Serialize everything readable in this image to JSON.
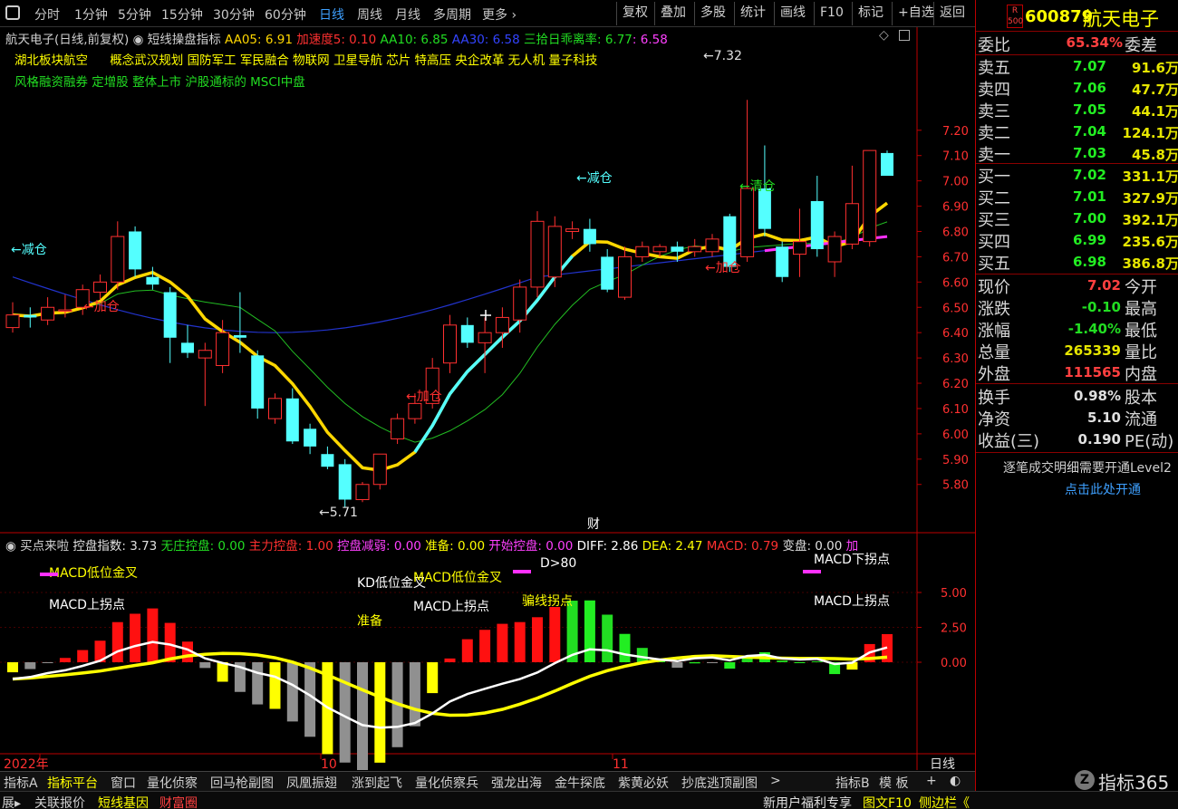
{
  "toolbar": {
    "periods": [
      "分时",
      "1分钟",
      "5分钟",
      "15分钟",
      "30分钟",
      "60分钟",
      "日线",
      "周线",
      "月线",
      "多周期",
      "更多"
    ],
    "active_period": "日线",
    "buttons": [
      "复权",
      "叠加",
      "多股",
      "统计",
      "画线",
      "F10",
      "标记",
      "+自选",
      "返回"
    ]
  },
  "main_legend": {
    "stock_name": "航天电子(日线,前复权)",
    "indicator_name": "短线操盘指标",
    "aa05": "AA05: 6.91",
    "accel": "加速度5: 0.10",
    "aa10": "AA10: 6.85",
    "aa30": "AA30: 6.58",
    "deviation_label": "三拾日乖离率: 6.77",
    "deviation_val": ": 6.58"
  },
  "concepts": {
    "line1_a": "湖北板块航空",
    "line1_b": "概念武汉规划 国防军工 军民融合 物联网 卫星导航 芯片 特高压 央企改革 无人机 量子科技",
    "line2": "风格融资融券 定增股 整体上市 沪股通标的 MSCI中盘"
  },
  "chart_data": [
    {
      "type": "candlestick",
      "title": "航天电子(日线,前复权)",
      "ylim": [
        5.62,
        7.5
      ],
      "y_ticks": [
        "7.20",
        "7.10",
        "7.00",
        "6.90",
        "6.80",
        "6.70",
        "6.60",
        "6.50",
        "6.40",
        "6.30",
        "6.20",
        "6.10",
        "6.00",
        "5.90",
        "5.80"
      ],
      "candles": [
        {
          "o": 6.42,
          "c": 6.47,
          "h": 6.52,
          "l": 6.4
        },
        {
          "o": 6.47,
          "c": 6.46,
          "h": 6.5,
          "l": 6.42
        },
        {
          "o": 6.45,
          "c": 6.5,
          "h": 6.54,
          "l": 6.43
        },
        {
          "o": 6.49,
          "c": 6.49,
          "h": 6.55,
          "l": 6.46
        },
        {
          "o": 6.5,
          "c": 6.57,
          "h": 6.59,
          "l": 6.47
        },
        {
          "o": 6.56,
          "c": 6.6,
          "h": 6.63,
          "l": 6.53
        },
        {
          "o": 6.6,
          "c": 6.78,
          "h": 6.84,
          "l": 6.57
        },
        {
          "o": 6.8,
          "c": 6.65,
          "h": 6.82,
          "l": 6.62
        },
        {
          "o": 6.62,
          "c": 6.59,
          "h": 6.66,
          "l": 6.57
        },
        {
          "o": 6.56,
          "c": 6.38,
          "h": 6.58,
          "l": 6.28
        },
        {
          "o": 6.36,
          "c": 6.32,
          "h": 6.43,
          "l": 6.3
        },
        {
          "o": 6.3,
          "c": 6.33,
          "h": 6.36,
          "l": 6.11
        },
        {
          "o": 6.27,
          "c": 6.4,
          "h": 6.45,
          "l": 6.24
        },
        {
          "o": 6.39,
          "c": 6.38,
          "h": 6.56,
          "l": 6.32
        },
        {
          "o": 6.31,
          "c": 6.1,
          "h": 6.33,
          "l": 6.06
        },
        {
          "o": 6.06,
          "c": 6.14,
          "h": 6.16,
          "l": 6.04
        },
        {
          "o": 6.14,
          "c": 5.97,
          "h": 6.18,
          "l": 5.96
        },
        {
          "o": 6.02,
          "c": 5.95,
          "h": 6.04,
          "l": 5.92
        },
        {
          "o": 5.92,
          "c": 5.87,
          "h": 5.95,
          "l": 5.86
        },
        {
          "o": 5.88,
          "c": 5.74,
          "h": 5.9,
          "l": 5.71
        },
        {
          "o": 5.74,
          "c": 5.8,
          "h": 5.81,
          "l": 5.73
        },
        {
          "o": 5.8,
          "c": 5.92,
          "h": 5.92,
          "l": 5.78
        },
        {
          "o": 5.98,
          "c": 6.06,
          "h": 6.08,
          "l": 5.96
        },
        {
          "o": 6.06,
          "c": 6.12,
          "h": 6.16,
          "l": 6.04
        },
        {
          "o": 6.12,
          "c": 6.26,
          "h": 6.3,
          "l": 6.1
        },
        {
          "o": 6.28,
          "c": 6.43,
          "h": 6.47,
          "l": 6.24
        },
        {
          "o": 6.43,
          "c": 6.36,
          "h": 6.46,
          "l": 6.34
        },
        {
          "o": 6.36,
          "c": 6.4,
          "h": 6.46,
          "l": 6.24
        },
        {
          "o": 6.4,
          "c": 6.46,
          "h": 6.5,
          "l": 6.34
        },
        {
          "o": 6.45,
          "c": 6.58,
          "h": 6.61,
          "l": 6.4
        },
        {
          "o": 6.58,
          "c": 6.84,
          "h": 6.88,
          "l": 6.54
        },
        {
          "o": 6.62,
          "c": 6.82,
          "h": 6.86,
          "l": 6.58
        },
        {
          "o": 6.8,
          "c": 6.81,
          "h": 6.84,
          "l": 6.77
        },
        {
          "o": 6.81,
          "c": 6.75,
          "h": 6.85,
          "l": 6.72
        },
        {
          "o": 6.7,
          "c": 6.57,
          "h": 6.73,
          "l": 6.56
        },
        {
          "o": 6.54,
          "c": 6.7,
          "h": 6.74,
          "l": 6.53
        },
        {
          "o": 6.7,
          "c": 6.74,
          "h": 6.76,
          "l": 6.68
        },
        {
          "o": 6.72,
          "c": 6.74,
          "h": 6.75,
          "l": 6.7
        },
        {
          "o": 6.74,
          "c": 6.72,
          "h": 6.76,
          "l": 6.68
        },
        {
          "o": 6.72,
          "c": 6.74,
          "h": 6.77,
          "l": 6.7
        },
        {
          "o": 6.72,
          "c": 6.77,
          "h": 6.79,
          "l": 6.7
        },
        {
          "o": 6.86,
          "c": 6.66,
          "h": 6.87,
          "l": 6.64
        },
        {
          "o": 6.7,
          "c": 6.97,
          "h": 7.32,
          "l": 6.68
        },
        {
          "o": 6.97,
          "c": 6.81,
          "h": 7.14,
          "l": 6.78
        },
        {
          "o": 6.74,
          "c": 6.62,
          "h": 6.76,
          "l": 6.6
        },
        {
          "o": 6.71,
          "c": 6.76,
          "h": 6.89,
          "l": 6.62
        },
        {
          "o": 6.92,
          "c": 6.73,
          "h": 7.02,
          "l": 6.7
        },
        {
          "o": 6.68,
          "c": 6.78,
          "h": 6.8,
          "l": 6.62
        },
        {
          "o": 6.75,
          "c": 6.91,
          "h": 7.06,
          "l": 6.73
        },
        {
          "o": 6.76,
          "c": 7.12,
          "h": 7.12,
          "l": 6.74
        },
        {
          "o": 7.11,
          "c": 7.02,
          "h": 7.12,
          "l": 7.02
        }
      ],
      "annotations": {
        "high_label": "7.32",
        "low_label": "5.71",
        "reduce1": "←减仓",
        "add1": "←加仓",
        "add2": "←加仓",
        "reduce2": "←减仓",
        "clear": "←清仓",
        "add3": "←加仓",
        "cai": "财"
      }
    },
    {
      "type": "bar",
      "title": "买点来啦",
      "ylim": [
        -3.2,
        6.0
      ],
      "y_ticks": [
        "5.00",
        "2.50",
        "0.00"
      ],
      "x_labels": [
        "2022年",
        "10",
        "11"
      ],
      "signals": {
        "s1": "MACD低位金叉",
        "s2": "MACD上拐点",
        "s3": "KD低位金叉",
        "s4": "准备",
        "s5": "MACD低位金叉",
        "s6": "MACD上拐点",
        "s7": "D>80",
        "s8": "骗线拐点",
        "s9": "MACD下拐点",
        "s10": "MACD上拐点"
      }
    }
  ],
  "sub_legend": {
    "name": "买点来啦",
    "kongpan": "控盘指数: 3.73",
    "wuzhuang": "无庄控盘: 0.00",
    "zhuli": "主力控盘: 1.00",
    "jianruo": "控盘减弱: 0.00",
    "zhunbei": "准备: 0.00",
    "kaishi": "开始控盘: 0.00",
    "diff": "DIFF: 2.86",
    "dea": "DEA: 2.47",
    "macd": "MACD: 0.79",
    "bianpan": "变盘: 0.00",
    "jia": "加"
  },
  "x_axis_right": "日线",
  "quote": {
    "badge_top": "R",
    "badge_bottom": "500",
    "code": "600879",
    "name": "航天电子",
    "weibi_label": "委比",
    "weibi_val": "65.34%",
    "weicha_label": "委差",
    "asks": [
      {
        "label": "卖五",
        "price": "7.07",
        "vol": "91.6万"
      },
      {
        "label": "卖四",
        "price": "7.06",
        "vol": "47.7万"
      },
      {
        "label": "卖三",
        "price": "7.05",
        "vol": "44.1万"
      },
      {
        "label": "卖二",
        "price": "7.04",
        "vol": "124.1万"
      },
      {
        "label": "卖一",
        "price": "7.03",
        "vol": "45.8万"
      }
    ],
    "bids": [
      {
        "label": "买一",
        "price": "7.02",
        "vol": "331.1万"
      },
      {
        "label": "买二",
        "price": "7.01",
        "vol": "327.9万"
      },
      {
        "label": "买三",
        "price": "7.00",
        "vol": "392.1万"
      },
      {
        "label": "买四",
        "price": "6.99",
        "vol": "235.6万"
      },
      {
        "label": "买五",
        "price": "6.98",
        "vol": "386.8万"
      }
    ],
    "stats": [
      {
        "l1": "现价",
        "v": "7.02",
        "l2": "今开",
        "color": "#ff4040"
      },
      {
        "l1": "涨跌",
        "v": "-0.10",
        "l2": "最高",
        "color": "#22dd22"
      },
      {
        "l1": "涨幅",
        "v": "-1.40%",
        "l2": "最低",
        "color": "#22dd22"
      },
      {
        "l1": "总量",
        "v": "265339",
        "l2": "量比",
        "color": "#e6e600"
      },
      {
        "l1": "外盘",
        "v": "111565",
        "l2": "内盘",
        "color": "#ff4040"
      }
    ],
    "stats2": [
      {
        "l1": "换手",
        "v": "0.98%",
        "l2": "股本"
      },
      {
        "l1": "净资",
        "v": "5.10",
        "l2": "流通"
      },
      {
        "l1": "收益(三)",
        "v": "0.190",
        "l2": "PE(动)"
      }
    ],
    "level2_msg": "逐笔成交明细需要开通Level2",
    "level2_link": "点击此处开通"
  },
  "tabs": [
    "指标A",
    "指标平台",
    "窗口",
    "量化侦察",
    "回马枪副图",
    "凤凰振翅",
    "涨到起飞",
    "量化侦察兵",
    "强龙出海",
    "金牛探底",
    "紫黄必妖",
    "抄底逃顶副图",
    ">",
    "指标B",
    "模 板",
    "+",
    "◐"
  ],
  "status": {
    "items": [
      "展▸",
      "关联报价",
      "短线基因",
      "财富圈"
    ],
    "right_items": [
      "新用户福利专享",
      "图文F10",
      "侧边栏《"
    ],
    "logo_text": "指标365"
  },
  "colors": {
    "up": "#ff3030",
    "down": "#54ffff",
    "ma5": "#ffd700",
    "ma10": "#22bb22",
    "ma30": "#2233cc",
    "bg": "#000000"
  }
}
